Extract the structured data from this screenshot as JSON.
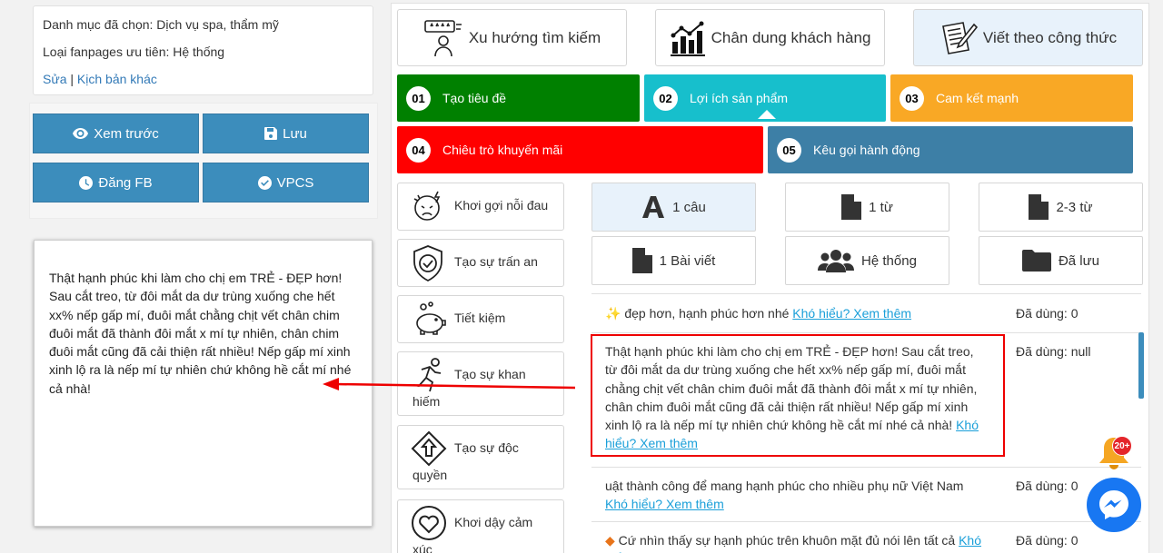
{
  "info": {
    "category": "Danh mục đã chọn: Dịch vụ spa, thẩm mỹ",
    "fanpage": "Loại fanpages ưu tiên: Hệ thống",
    "edit_link": "Sửa",
    "separator": "|",
    "other_link": "Kịch bản khác"
  },
  "actions": {
    "preview": "Xem trước",
    "save": "Lưu",
    "post_fb": "Đăng FB",
    "vpcs": "VPCS"
  },
  "preview_text": "Thật hạnh phúc khi làm cho chị em TRẺ - ĐẸP hơn! Sau cắt treo, từ đôi mắt da dư trùng xuống che hết xx% nếp gấp mí, đuôi mắt chằng chịt vết chân chim đuôi mắt đã thành đôi mắt x mí tự nhiên, chân chim đuôi mắt cũng đã cải thiện rất nhiều! Nếp gấp mí xinh xinh lộ ra là nếp mí tự nhiên chứ không hề cắt mí nhé cả nhà!",
  "top_tabs": [
    {
      "label": "Xu hướng tìm kiếm",
      "icon": "search-trend-icon"
    },
    {
      "label": "Chân dung khách hàng",
      "icon": "bar-chart-icon"
    },
    {
      "label": "Viết theo công thức",
      "icon": "write-note-icon",
      "active": true
    }
  ],
  "steps": [
    {
      "num": "01",
      "label": "Tạo tiêu đề",
      "color": "#008000"
    },
    {
      "num": "02",
      "label": "Lợi ích sản phẩm",
      "color": "#17bfcc"
    },
    {
      "num": "03",
      "label": "Cam kết mạnh",
      "color": "#f9a825"
    },
    {
      "num": "04",
      "label": "Chiêu trò khuyến mãi",
      "color": "#ff0000"
    },
    {
      "num": "05",
      "label": "Kêu gọi hành động",
      "color": "#3d7fa6"
    }
  ],
  "side_options": [
    {
      "label": "Khơi gợi nỗi đau",
      "icon": "pain-face-icon"
    },
    {
      "label": "Tạo sự trấn an",
      "icon": "shield-check-icon"
    },
    {
      "label": "Tiết kiệm",
      "icon": "piggy-bank-icon"
    },
    {
      "label_1": "Tạo sự khan",
      "label_2": "hiếm",
      "icon": "running-person-icon"
    },
    {
      "label_1": "Tạo sự độc",
      "label_2": "quyền",
      "icon": "diamond-arrow-icon"
    },
    {
      "label_1": "Khơi dậy cảm",
      "label_2": "xúc",
      "icon": "heart-icon"
    }
  ],
  "filters": [
    {
      "label": "1 câu",
      "icon": "letter-a-icon",
      "active": true
    },
    {
      "label": "1 từ",
      "icon": "file-icon"
    },
    {
      "label": "2-3 từ",
      "icon": "file-icon"
    },
    {
      "label": "1 Bài viết",
      "icon": "file-icon"
    },
    {
      "label": "Hệ thống",
      "icon": "users-icon"
    },
    {
      "label": "Đã lưu",
      "icon": "folder-icon"
    }
  ],
  "results": [
    {
      "text": "đẹp hơn, hạnh phúc hơn nhé",
      "link": "Khó hiểu? Xem thêm",
      "used": "Đã dùng: 0"
    },
    {
      "text": "Thật hạnh phúc khi làm cho chị em TRẺ - ĐẸP hơn! Sau cắt treo, từ đôi mắt da dư trùng xuống che hết xx% nếp gấp mí, đuôi mắt chằng chịt vết chân chim đuôi mắt đã thành đôi mắt x mí tự nhiên, chân chim đuôi mắt cũng đã cải thiện rất nhiều! Nếp gấp mí xinh xinh lộ ra là nếp mí tự nhiên chứ không hề cắt mí nhé cả nhà!",
      "link": "Khó hiểu? Xem thêm",
      "used": "Đã dùng: null"
    },
    {
      "text": "uật thành công để mang hạnh phúc cho nhiều phụ nữ Việt Nam",
      "link": "Khó hiểu? Xem thêm",
      "used": "Đã dùng: 0"
    },
    {
      "text": "Cứ nhìn thấy sự hạnh phúc trên khuôn mặt đủ nói lên tất cả",
      "link": "Khó hiểu? Xem thêm",
      "used": "Đã dùng: 0"
    }
  ],
  "notification_count": "20+"
}
